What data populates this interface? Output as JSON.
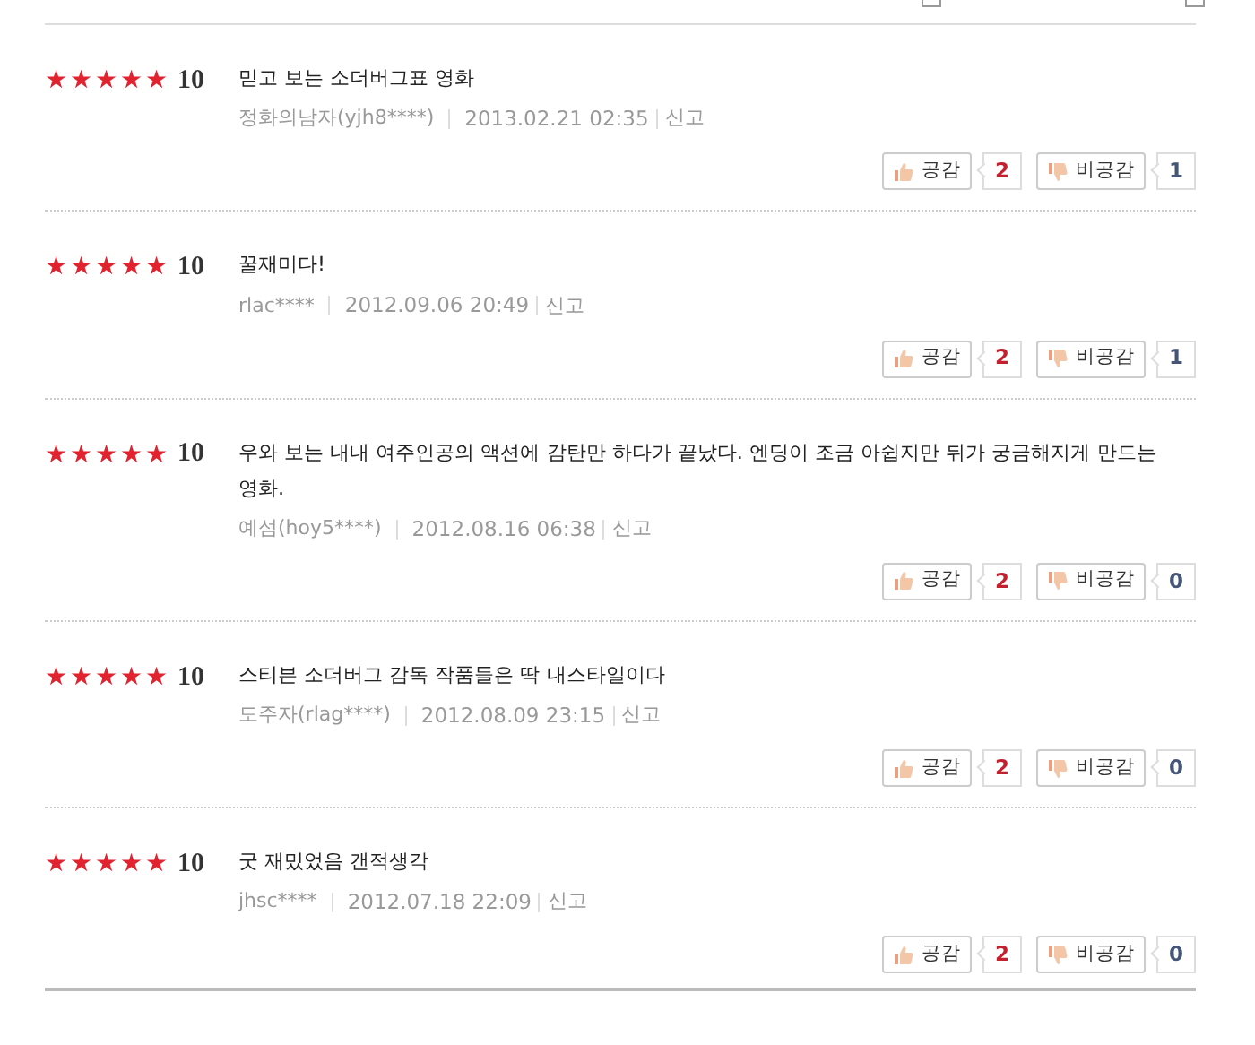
{
  "reviews": [
    {
      "stars": 5,
      "score": "10",
      "text": "믿고 보는 소더버그표 영화",
      "author": "정화의남자(yjh8****)",
      "date": "2013.02.21 02:35",
      "report": "신고",
      "like_label": "공감",
      "like_count": "2",
      "dislike_label": "비공감",
      "dislike_count": "1"
    },
    {
      "stars": 5,
      "score": "10",
      "text": "꿀재미다!",
      "author": "rlac****",
      "date": "2012.09.06 20:49",
      "report": "신고",
      "like_label": "공감",
      "like_count": "2",
      "dislike_label": "비공감",
      "dislike_count": "1"
    },
    {
      "stars": 5,
      "score": "10",
      "text": "우와 보는 내내 여주인공의 액션에 감탄만 하다가 끝났다. 엔딩이 조금 아쉽지만 뒤가 궁금해지게 만드는 영화.",
      "author": "예섬(hoy5****)",
      "date": "2012.08.16 06:38",
      "report": "신고",
      "like_label": "공감",
      "like_count": "2",
      "dislike_label": "비공감",
      "dislike_count": "0"
    },
    {
      "stars": 5,
      "score": "10",
      "text": "스티븐 소더버그 감독 작품들은 딱 내스타일이다",
      "author": "도주자(rlag****)",
      "date": "2012.08.09 23:15",
      "report": "신고",
      "like_label": "공감",
      "like_count": "2",
      "dislike_label": "비공감",
      "dislike_count": "0"
    },
    {
      "stars": 5,
      "score": "10",
      "text": "굿 재밌었음 갠적생각",
      "author": "jhsc****",
      "date": "2012.07.18 22:09",
      "report": "신고",
      "like_label": "공감",
      "like_count": "2",
      "dislike_label": "비공감",
      "dislike_count": "0"
    }
  ]
}
